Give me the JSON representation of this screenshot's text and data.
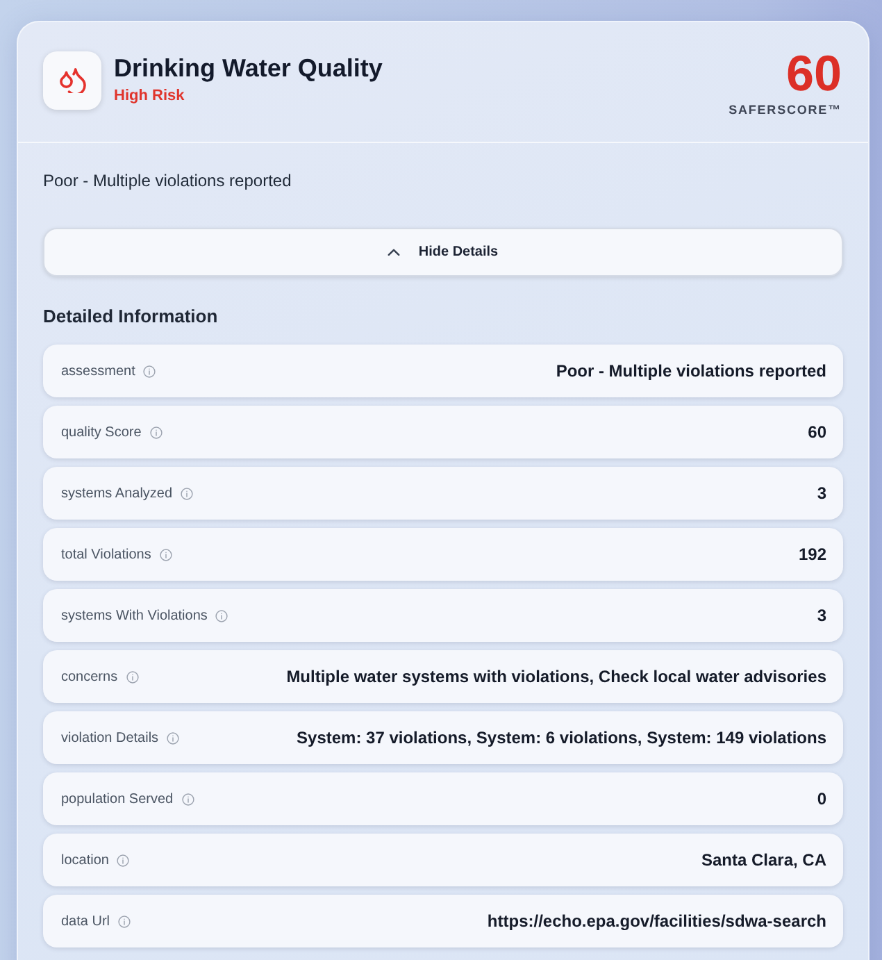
{
  "header": {
    "title": "Drinking Water Quality",
    "risk_label": "High Risk",
    "score": "60",
    "score_label": "SAFERSCORE™"
  },
  "summary": "Poor - Multiple violations reported",
  "toggle_button": {
    "label": "Hide Details",
    "expanded": true
  },
  "details": {
    "heading": "Detailed Information",
    "rows": [
      {
        "label": "assessment",
        "value": "Poor - Multiple violations reported"
      },
      {
        "label": "quality Score",
        "value": "60"
      },
      {
        "label": "systems Analyzed",
        "value": "3"
      },
      {
        "label": "total Violations",
        "value": "192"
      },
      {
        "label": "systems With Violations",
        "value": "3"
      },
      {
        "label": "concerns",
        "value": "Multiple water systems with violations, Check local water advisories"
      },
      {
        "label": "violation Details",
        "value": "System: 37 violations, System: 6 violations, System: 149 violations"
      },
      {
        "label": "population Served",
        "value": "0"
      },
      {
        "label": "location",
        "value": "Santa Clara, CA"
      },
      {
        "label": "data Url",
        "value": "https://echo.epa.gov/facilities/sdwa-search"
      }
    ]
  }
}
